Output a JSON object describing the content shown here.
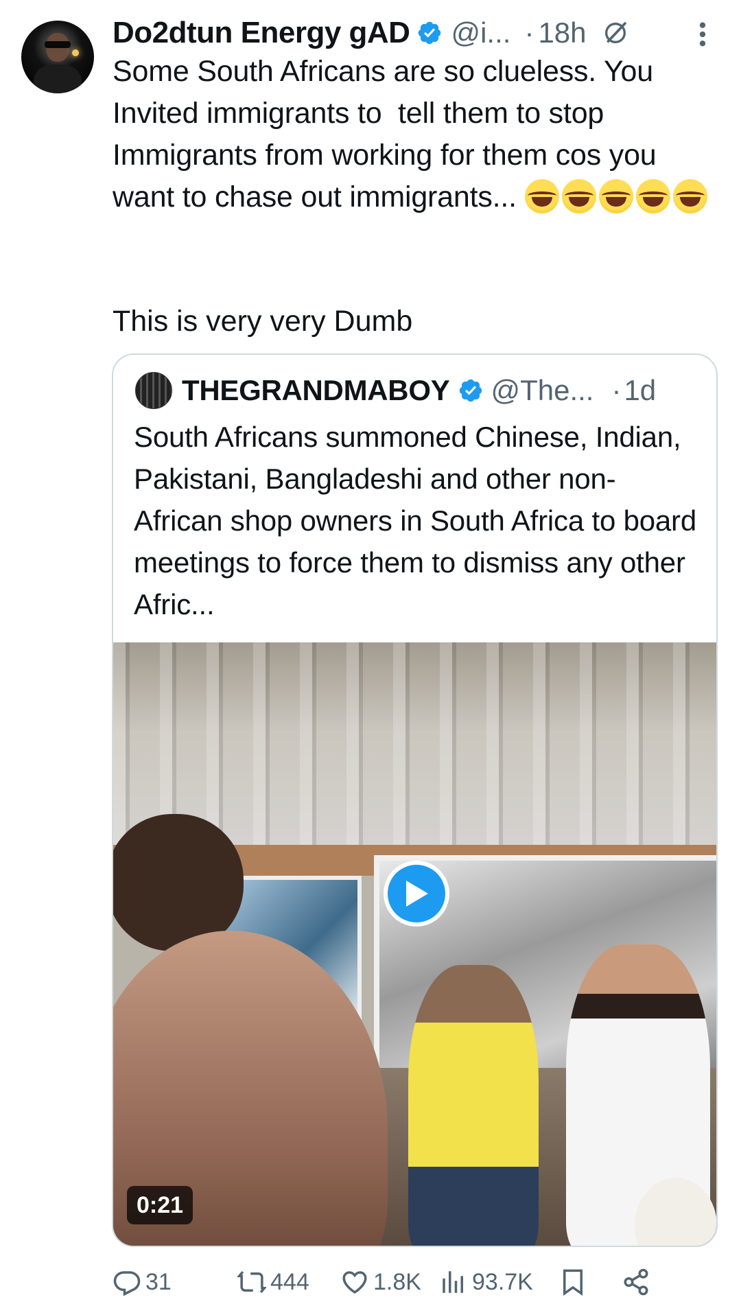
{
  "tweet": {
    "author_name": "Do2dtun Energy gAD",
    "handle": "@i...",
    "dot": "·",
    "time": "18h",
    "text_main": "Some South Africans are so clueless. You Invited immigrants to  tell them to stop Immigrants from working for them cos you want to chase out immigrants... ",
    "emoji_count": 5,
    "text_second": "This is very very Dumb"
  },
  "quote": {
    "author_name": "THEGRANDMABOY",
    "handle": "@The...",
    "dot": "·",
    "time": "1d",
    "text": "South Africans summoned Chinese, Indian, Pakistani, Bangladeshi and other non-African shop owners in South Africa to board meetings to force them to dismiss any other Afric...",
    "video_duration": "0:21"
  },
  "actions": {
    "replies": "31",
    "reposts": "444",
    "likes": "1.8K",
    "views": "93.7K"
  },
  "colors": {
    "accent": "#1d9bf0",
    "secondary_text": "#536471",
    "border": "#cfd9de"
  },
  "icons": [
    "verified-badge-icon",
    "grok-icon",
    "more-icon",
    "play-icon",
    "reply-icon",
    "repost-icon",
    "like-icon",
    "views-icon",
    "bookmark-icon",
    "share-icon"
  ]
}
